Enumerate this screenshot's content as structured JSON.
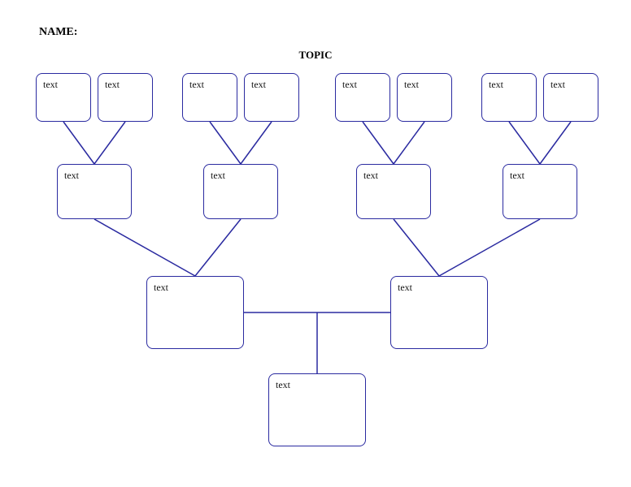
{
  "header": {
    "name_label": "NAME:",
    "topic_label": "TOPIC"
  },
  "colors": {
    "box_border": "#2a2aa0",
    "connector": "#2a2aa0"
  },
  "row1": [
    {
      "label": "text"
    },
    {
      "label": "text"
    },
    {
      "label": "text"
    },
    {
      "label": "text"
    },
    {
      "label": "text"
    },
    {
      "label": "text"
    },
    {
      "label": "text"
    },
    {
      "label": "text"
    }
  ],
  "row2": [
    {
      "label": "text"
    },
    {
      "label": "text"
    },
    {
      "label": "text"
    },
    {
      "label": "text"
    }
  ],
  "row3": [
    {
      "label": "text"
    },
    {
      "label": "text"
    }
  ],
  "row4": [
    {
      "label": "text"
    }
  ]
}
